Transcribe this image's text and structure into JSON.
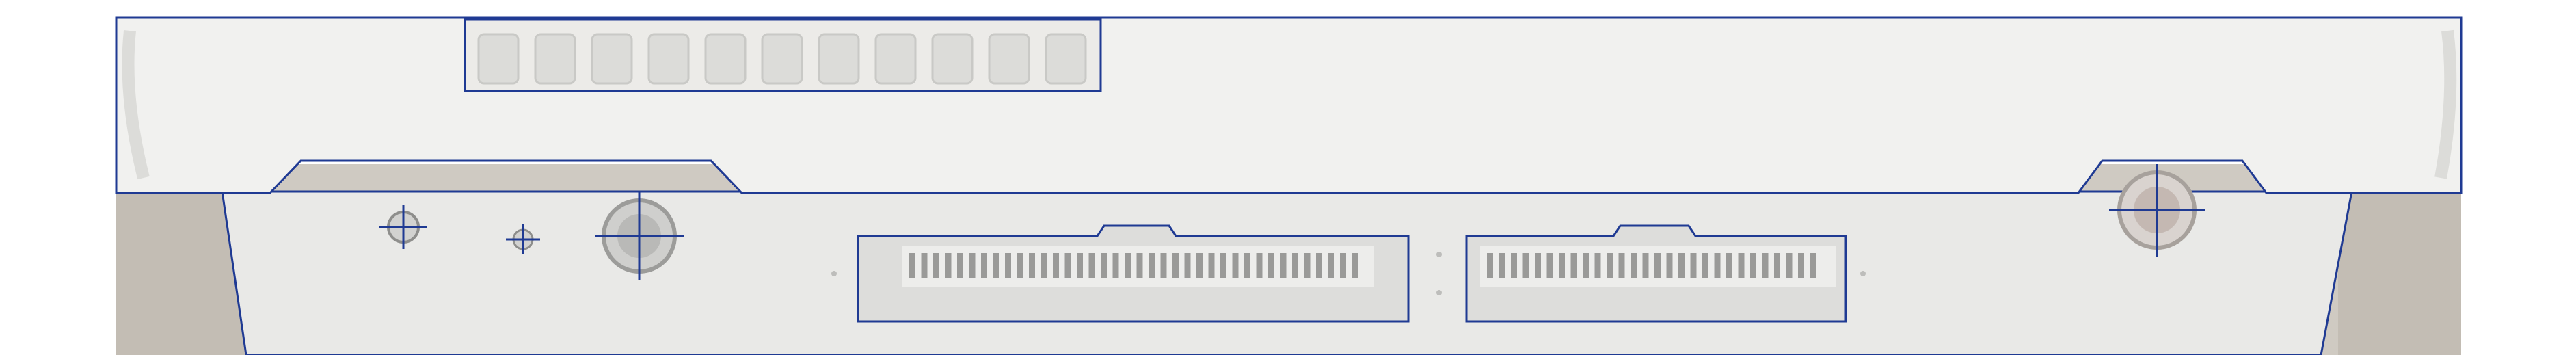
{
  "image": {
    "subject": "device-back-panel",
    "outline_color": "#1f3a93",
    "body_color": "#f1f1ef",
    "panel_color": "#e9e9e7",
    "backdrop_color": "#cfcac2",
    "port_fill": "#d7d7d5",
    "pin_color": "#9a9a98"
  },
  "regions": {
    "top_housing": {
      "label": ""
    },
    "vent_grille": {
      "label": ""
    },
    "connector_panel": {
      "label": ""
    },
    "port_left_small_1": {
      "label": ""
    },
    "port_left_small_2": {
      "label": ""
    },
    "port_left_round": {
      "label": ""
    },
    "connector_wide_1": {
      "label": ""
    },
    "connector_wide_2": {
      "label": ""
    },
    "port_right_round": {
      "label": ""
    }
  }
}
